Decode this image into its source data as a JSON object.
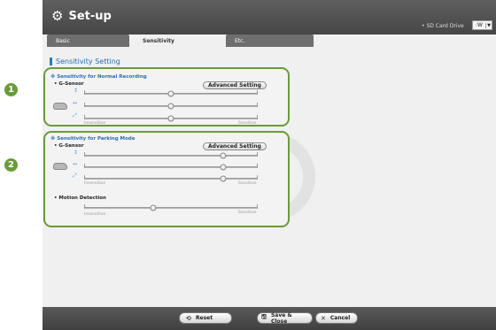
{
  "markers": [
    "1",
    "2"
  ],
  "header": {
    "title": "Set-up",
    "gear_icon": "gear-icon",
    "sd_label": "• SD Card Drive",
    "sd_value": ":W"
  },
  "tabs": [
    {
      "label": "Basic",
      "active": false
    },
    {
      "label": "Sensitivity",
      "active": true
    },
    {
      "label": "Etc.",
      "active": false
    }
  ],
  "section": {
    "title": "Sensitivity Setting"
  },
  "normal": {
    "title": "※ Sensitivity for Normal Recording",
    "gsensor_label": "• G-Sensor",
    "advanced_label": "Advanced Setting",
    "sliders": [
      {
        "axis": "vertical",
        "icon": "↕",
        "value": 0.5
      },
      {
        "axis": "horizontal",
        "icon": "↔",
        "value": 0.5
      },
      {
        "axis": "diagonal",
        "icon": "⤢",
        "value": 0.5
      }
    ],
    "min_label": "Insensitive",
    "max_label": "Sensitive"
  },
  "parking": {
    "title": "※ Sensitivity for Parking Mode",
    "gsensor_label": "• G-Sensor",
    "advanced_label": "Advanced Setting",
    "sliders": [
      {
        "axis": "vertical",
        "icon": "↕",
        "value": 0.8
      },
      {
        "axis": "horizontal",
        "icon": "↔",
        "value": 0.8
      },
      {
        "axis": "diagonal",
        "icon": "⤢",
        "value": 0.8
      }
    ],
    "min_label": "Insensitive",
    "max_label": "Sensitive",
    "motion": {
      "label": "• Motion Detection",
      "value": 0.4,
      "min_label": "Insensitive",
      "max_label": "Sensitive"
    }
  },
  "footer": {
    "reset_label": "Reset",
    "save_label": "Save & Close",
    "cancel_label": "Cancel"
  }
}
